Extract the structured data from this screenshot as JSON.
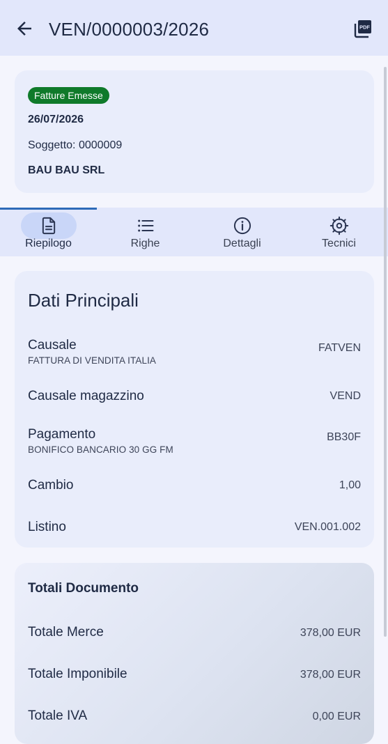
{
  "appbar": {
    "title": "VEN/0000003/2026",
    "back_icon": "arrow-left-icon",
    "pdf_icon": "pdf-icon"
  },
  "header": {
    "badge": "Fatture Emesse",
    "badge_color": "#0f7a2a",
    "date": "26/07/2026",
    "soggetto": "Soggetto: 0000009",
    "ragione_sociale": "BAU BAU SRL"
  },
  "tabs": [
    {
      "label": "Riepilogo",
      "icon": "document-icon",
      "active": true
    },
    {
      "label": "Righe",
      "icon": "list-icon",
      "active": false
    },
    {
      "label": "Dettagli",
      "icon": "info-icon",
      "active": false
    },
    {
      "label": "Tecnici",
      "icon": "gear-icon",
      "active": false
    }
  ],
  "dati_principali": {
    "title": "Dati Principali",
    "rows": [
      {
        "label": "Causale",
        "sub": "FATTURA DI VENDITA ITALIA",
        "value": "FATVEN"
      },
      {
        "label": "Causale magazzino",
        "sub": "",
        "value": "VEND"
      },
      {
        "label": "Pagamento",
        "sub": "BONIFICO BANCARIO 30 GG FM",
        "value": "BB30F"
      },
      {
        "label": "Cambio",
        "sub": "",
        "value": "1,00"
      },
      {
        "label": "Listino",
        "sub": "",
        "value": "VEN.001.002"
      }
    ]
  },
  "totali": {
    "title": "Totali Documento",
    "rows": [
      {
        "label": "Totale Merce",
        "value": "378,00 EUR"
      },
      {
        "label": "Totale Imponibile",
        "value": "378,00 EUR"
      },
      {
        "label": "Totale IVA",
        "value": "0,00 EUR"
      }
    ]
  },
  "colors": {
    "appbar": "#e2e7fb",
    "card": "#e9edfb",
    "tab_indicator": "#2d6ab8",
    "active_pill": "#c9d6f8"
  }
}
